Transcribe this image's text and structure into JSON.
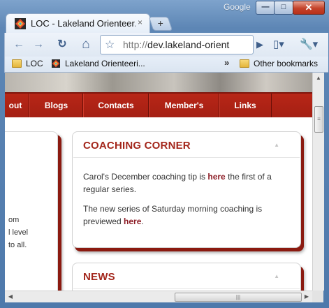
{
  "window": {
    "google_label": "Google",
    "min_glyph": "—",
    "max_glyph": "□",
    "close_glyph": "✕"
  },
  "tab": {
    "title": "LOC - Lakeland Orienteer...",
    "close_glyph": "×",
    "new_tab_glyph": "+"
  },
  "toolbar": {
    "back_glyph": "←",
    "forward_glyph": "→",
    "reload_glyph": "↻",
    "home_glyph": "⌂",
    "star_glyph": "☆",
    "url_scheme": "http://",
    "url_host": "dev.lakeland-orient",
    "go_glyph": "▶",
    "page_menu_glyph": "▯▾",
    "wrench_glyph": "🔧▾"
  },
  "bookmarks": {
    "items": [
      {
        "label": "LOC"
      },
      {
        "label": "Lakeland Orienteeri..."
      }
    ],
    "overflow_glyph": "»",
    "other_label": "Other bookmarks"
  },
  "nav": {
    "items": [
      {
        "label": "out"
      },
      {
        "label": "Blogs"
      },
      {
        "label": "Contacts"
      },
      {
        "label": "Member's"
      },
      {
        "label": "Links"
      }
    ]
  },
  "left_text": {
    "lines": [
      "om",
      "l level",
      "to all."
    ]
  },
  "coaching": {
    "title": "COACHING CORNER",
    "collapse_glyph": "▲",
    "p1_before": "Carol's December coaching tip is ",
    "p1_link": "here",
    "p1_after": " the first of a regular series.",
    "p2_before": "The new series of Saturday morning coaching is previewed ",
    "p2_link": "here",
    "p2_after": "."
  },
  "news": {
    "title": "NEWS",
    "collapse_glyph": "▲"
  },
  "scroll": {
    "up": "▲",
    "left": "◀",
    "right": "▶",
    "grip": "≡",
    "hgrip": "|||"
  },
  "colors": {
    "brand_red": "#a3261b",
    "nav_red": "#b82617",
    "link": "#8c1c25"
  }
}
